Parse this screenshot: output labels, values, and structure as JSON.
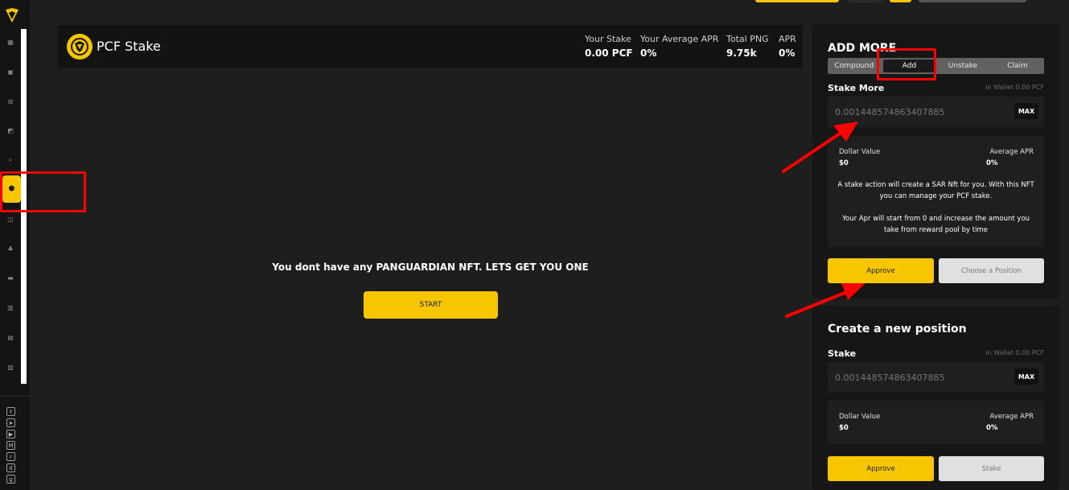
{
  "header": {
    "title": "PCF Stake",
    "stats": [
      {
        "label": "Your Stake",
        "value": "0.00 PCF"
      },
      {
        "label": "Your Average APR",
        "value": "0%"
      },
      {
        "label": "Total PNG",
        "value": "9.75k"
      },
      {
        "label": "APR",
        "value": "0%"
      }
    ]
  },
  "empty_state": {
    "message": "You dont have any PANGUARDIAN NFT. LETS GET YOU ONE",
    "start_label": "START"
  },
  "add_more": {
    "title": "ADD MORE",
    "tabs": [
      "Compound",
      "Add",
      "Unstake",
      "Claim"
    ],
    "active_tab": "Add",
    "stake_label": "Stake More",
    "wallet": "in Wallet 0.00 PCF",
    "placeholder": "0.001448574863407885",
    "max_label": "MAX",
    "dollar_label": "Dollar Value",
    "dollar_value": "$0",
    "apr_label": "Average APR",
    "apr_value": "0%",
    "note1": "A stake action will create a SAR Nft for you. With this NFT you can manage your PCF stake.",
    "note2": "Your Apr will start from 0 and increase the amount you take from reward pool by time",
    "approve_label": "Approve",
    "choose_label": "Choose a Position"
  },
  "new_position": {
    "title": "Create a new position",
    "stake_label": "Stake",
    "wallet": "in Wallet 0.00 PCF",
    "placeholder": "0.001448574863407885",
    "max_label": "MAX",
    "dollar_label": "Dollar Value",
    "dollar_value": "$0",
    "apr_label": "Average APR",
    "apr_value": "0%",
    "approve_label": "Approve",
    "stake_button_label": "Stake"
  },
  "colors": {
    "accent": "#f7c600",
    "background": "#1e1e1e",
    "card": "#161616",
    "annotation": "#ff0000"
  },
  "sidebar": {
    "nav_icons": [
      "dashboard-icon",
      "calendar-icon",
      "cart-icon",
      "chart-icon",
      "search-icon",
      "stake-icon",
      "gift-icon",
      "tree-icon",
      "bank-icon",
      "building-icon",
      "card-icon",
      "lab-icon"
    ],
    "social_icons": [
      "twitter-icon",
      "telegram-icon",
      "youtube-icon",
      "medium-icon",
      "reddit-icon",
      "discord-icon",
      "github-icon"
    ]
  }
}
